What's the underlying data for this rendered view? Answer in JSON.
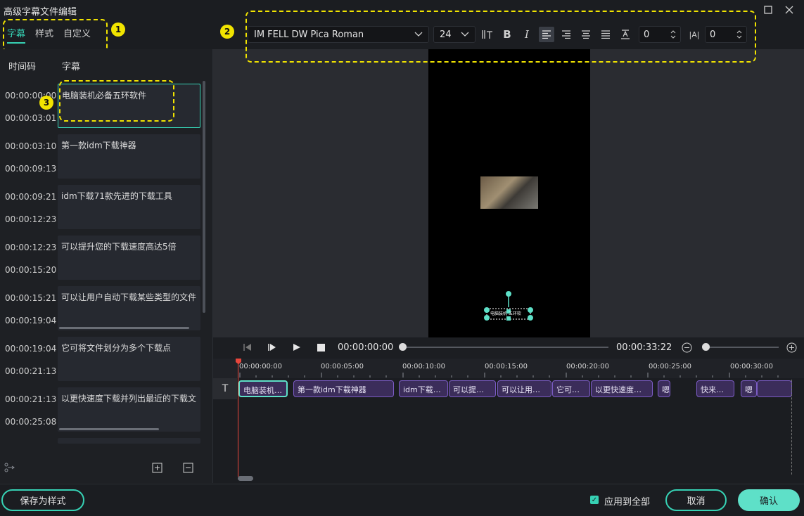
{
  "window": {
    "title": "高级字幕文件编辑"
  },
  "tabs": [
    {
      "label": "字幕",
      "active": true
    },
    {
      "label": "样式"
    },
    {
      "label": "自定义"
    }
  ],
  "annotations": [
    "1",
    "2",
    "3"
  ],
  "list": {
    "col_time": "时间码",
    "col_sub": "字幕",
    "rows": [
      {
        "start": "00:00:00:00",
        "end": "00:00:03:01",
        "text": "电脑装机必备五环软件"
      },
      {
        "start": "00:00:03:10",
        "end": "00:00:09:13",
        "text": "第一款idm下载神器"
      },
      {
        "start": "00:00:09:21",
        "end": "00:00:12:23",
        "text": "idm下载71款先进的下载工具"
      },
      {
        "start": "00:00:12:23",
        "end": "00:00:15:20",
        "text": "可以提升您的下载速度高达5倍"
      },
      {
        "start": "00:00:15:21",
        "end": "00:00:19:04",
        "text": "可以让用户自动下载某些类型的文件"
      },
      {
        "start": "00:00:19:04",
        "end": "00:00:21:13",
        "text": "它可将文件划分为多个下载点"
      },
      {
        "start": "00:00:21:13",
        "end": "00:00:25:08",
        "text": "以更快速度下载并列出最近的下载文"
      }
    ]
  },
  "toolbar": {
    "font": "IM FELL DW Pica Roman",
    "size": "24",
    "bold": "B",
    "italic": "I",
    "spacing_value": "0",
    "line_value": "0",
    "line_icon_text": "|A|"
  },
  "transport": {
    "current": "00:00:00:00",
    "duration": "00:00:33:22"
  },
  "ruler": [
    "00:00:00:00",
    "00:00:05:00",
    "00:00:10:00",
    "00:00:15:00",
    "00:00:20:00",
    "00:00:25:00",
    "00:00:30:00"
  ],
  "track_icon": "T",
  "clips": [
    "电脑装机…",
    "第一款idm下载神器",
    "idm下载…",
    "可以提…",
    "可以让用…",
    "它可…",
    "以更快速度…",
    "嗯",
    "快来…",
    "嗯",
    ""
  ],
  "preview_caption": "电脑装机 五环软",
  "bottom": {
    "save_style": "保存为样式",
    "apply_all": "应用到全部",
    "cancel": "取消",
    "confirm": "确认"
  },
  "colors": {
    "accent": "#36d1b4",
    "confirm_bg": "#5ee0c8",
    "clip_bg": "#3b2d5a",
    "clip_border": "#7b5cc4",
    "annotation": "#f1e400",
    "playhead": "#e8463c"
  }
}
